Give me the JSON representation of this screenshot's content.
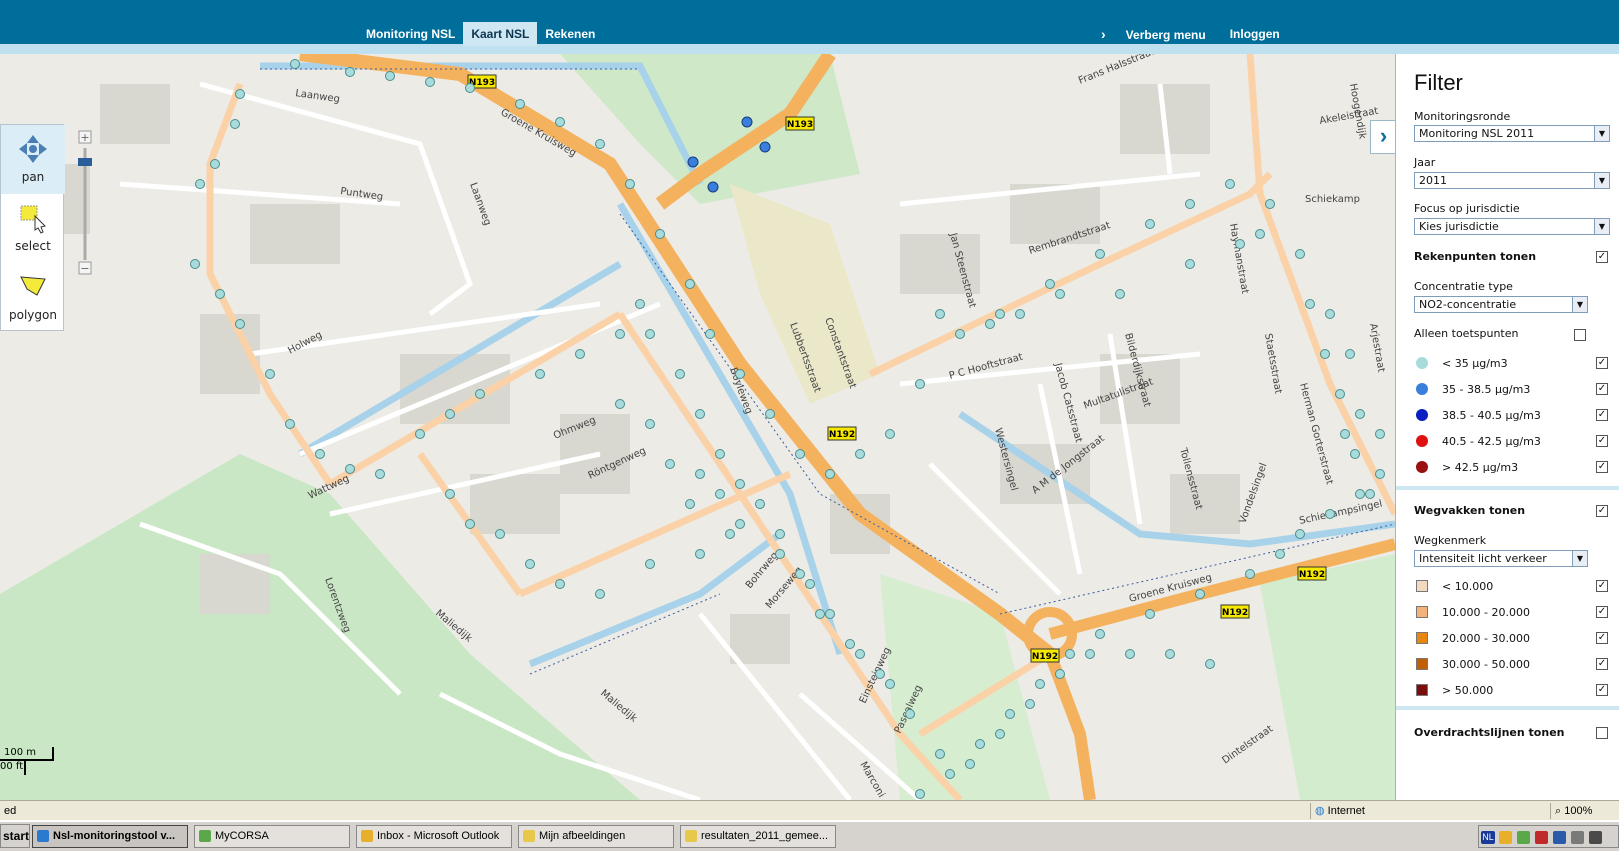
{
  "header": {
    "nav_left": [
      "Monitoring NSL",
      "Kaart NSL",
      "Rekenen"
    ],
    "active_tab": "Kaart NSL",
    "hide_menu_label": "Verberg menu",
    "login_label": "Inloggen"
  },
  "tools": {
    "pan": "pan",
    "select": "select",
    "polygon": "polygon"
  },
  "map": {
    "scale_metric": "100 m",
    "scale_imperial": "00 ft",
    "road_labels": {
      "laanweg_top": "Laanweg",
      "puntweg": "Puntweg",
      "laanweg_side": "Laanweg",
      "holweg": "Holweg",
      "ohmweg": "Ohmweg",
      "rontgenweg": "Röntgenweg",
      "wattweg": "Wattweg",
      "lorentzweg": "Lorentzweg",
      "maliedijk_1": "Maliedijk",
      "maliedijk_2": "Maliedijk",
      "boyleweg": "Boyleweg",
      "bohrweg": "Bohrweg",
      "morseweg": "Morseweg",
      "einsteinweg": "Einsteinweg",
      "pascalweg": "Pascalweg",
      "marconi": "Marconi",
      "groene_kruisweg_top": "Groene Kruisweg",
      "groene_kruisweg_bottom": "Groene Kruisweg",
      "lubbertsstraat": "Lubbertsstraat",
      "constantstraat": "Constantstraat",
      "frans_halsstraat": "Frans Halsstraat",
      "jan_steenstraat": "Jan Steenstraat",
      "rembrandtstraat": "Rembrandtstraat",
      "hoogendijk": "Hoogendijk",
      "p_c_hooftstraat": "P C Hooftstraat",
      "jacob_catsstraat": "Jacob Catsstraat",
      "bilderdijkstraat": "Bilderdijkstraat",
      "multatulistraat": "Multatulistraat",
      "westersingel": "Westersingel",
      "a_m_de_jongstraat": "A M de Jongstraat",
      "tollensstraat": "Tollensstraat",
      "vondelsingel": "Vondelsingel",
      "schiekampsingel": "Schiekampsingel",
      "haymanstraat": "Haymanstraat",
      "staetsstraat": "Staetsstraat",
      "herman_gorterstraat": "Herman Gorterstraat",
      "akeleistraat": "Akeleistraat",
      "schiekamp": "Schiekamp",
      "dintelstraat": "Dintelstraat",
      "arjestraat": "Arjestraat"
    },
    "route_shields": [
      "N193",
      "N193",
      "N192",
      "N192",
      "N192",
      "N192"
    ]
  },
  "filter": {
    "title": "Filter",
    "monitoringsronde_label": "Monitoringsronde",
    "monitoringsronde_value": "Monitoring NSL 2011",
    "jaar_label": "Jaar",
    "jaar_value": "2011",
    "focus_label": "Focus op jurisdictie",
    "focus_value": "Kies jurisdictie",
    "rekenpunten_label": "Rekenpunten tonen",
    "concentratie_label": "Concentratie type",
    "concentratie_value": "NO2-concentratie",
    "toetspunten_label": "Alleen toetspunten",
    "concentration_legend": [
      {
        "label": "< 35 µg/m3",
        "color": "#a8dcdc",
        "checked": true
      },
      {
        "label": "35 - 38.5 µg/m3",
        "color": "#3a7fdc",
        "checked": true
      },
      {
        "label": "38.5 - 40.5 µg/m3",
        "color": "#0a1fc0",
        "checked": true
      },
      {
        "label": "40.5 - 42.5 µg/m3",
        "color": "#e01010",
        "checked": true
      },
      {
        "label": "> 42.5 µg/m3",
        "color": "#9a1010",
        "checked": true
      }
    ],
    "wegvakken_label": "Wegvakken tonen",
    "wegkenmerk_label": "Wegkenmerk",
    "wegkenmerk_value": "Intensiteit licht verkeer",
    "traffic_legend": [
      {
        "label": "< 10.000",
        "color": "#f3d9c0",
        "checked": true
      },
      {
        "label": "10.000 - 20.000",
        "color": "#f2b27a",
        "checked": true
      },
      {
        "label": "20.000 - 30.000",
        "color": "#e8860e",
        "checked": true
      },
      {
        "label": "30.000 - 50.000",
        "color": "#c25e08",
        "checked": true
      },
      {
        "label": "> 50.000",
        "color": "#7a0e0e",
        "checked": true
      }
    ],
    "overdracht_label": "Overdrachtslijnen tonen"
  },
  "statusbar": {
    "left_text": "ed",
    "zone": "Internet",
    "zoom": "100%"
  },
  "taskbar": {
    "start_label": "start",
    "tasks": [
      "Nsl-monitoringstool v...",
      "MyCORSA",
      "Inbox - Microsoft Outlook",
      "Mijn afbeeldingen",
      "resultaten_2011_gemee..."
    ],
    "tray_lang": "NL"
  }
}
